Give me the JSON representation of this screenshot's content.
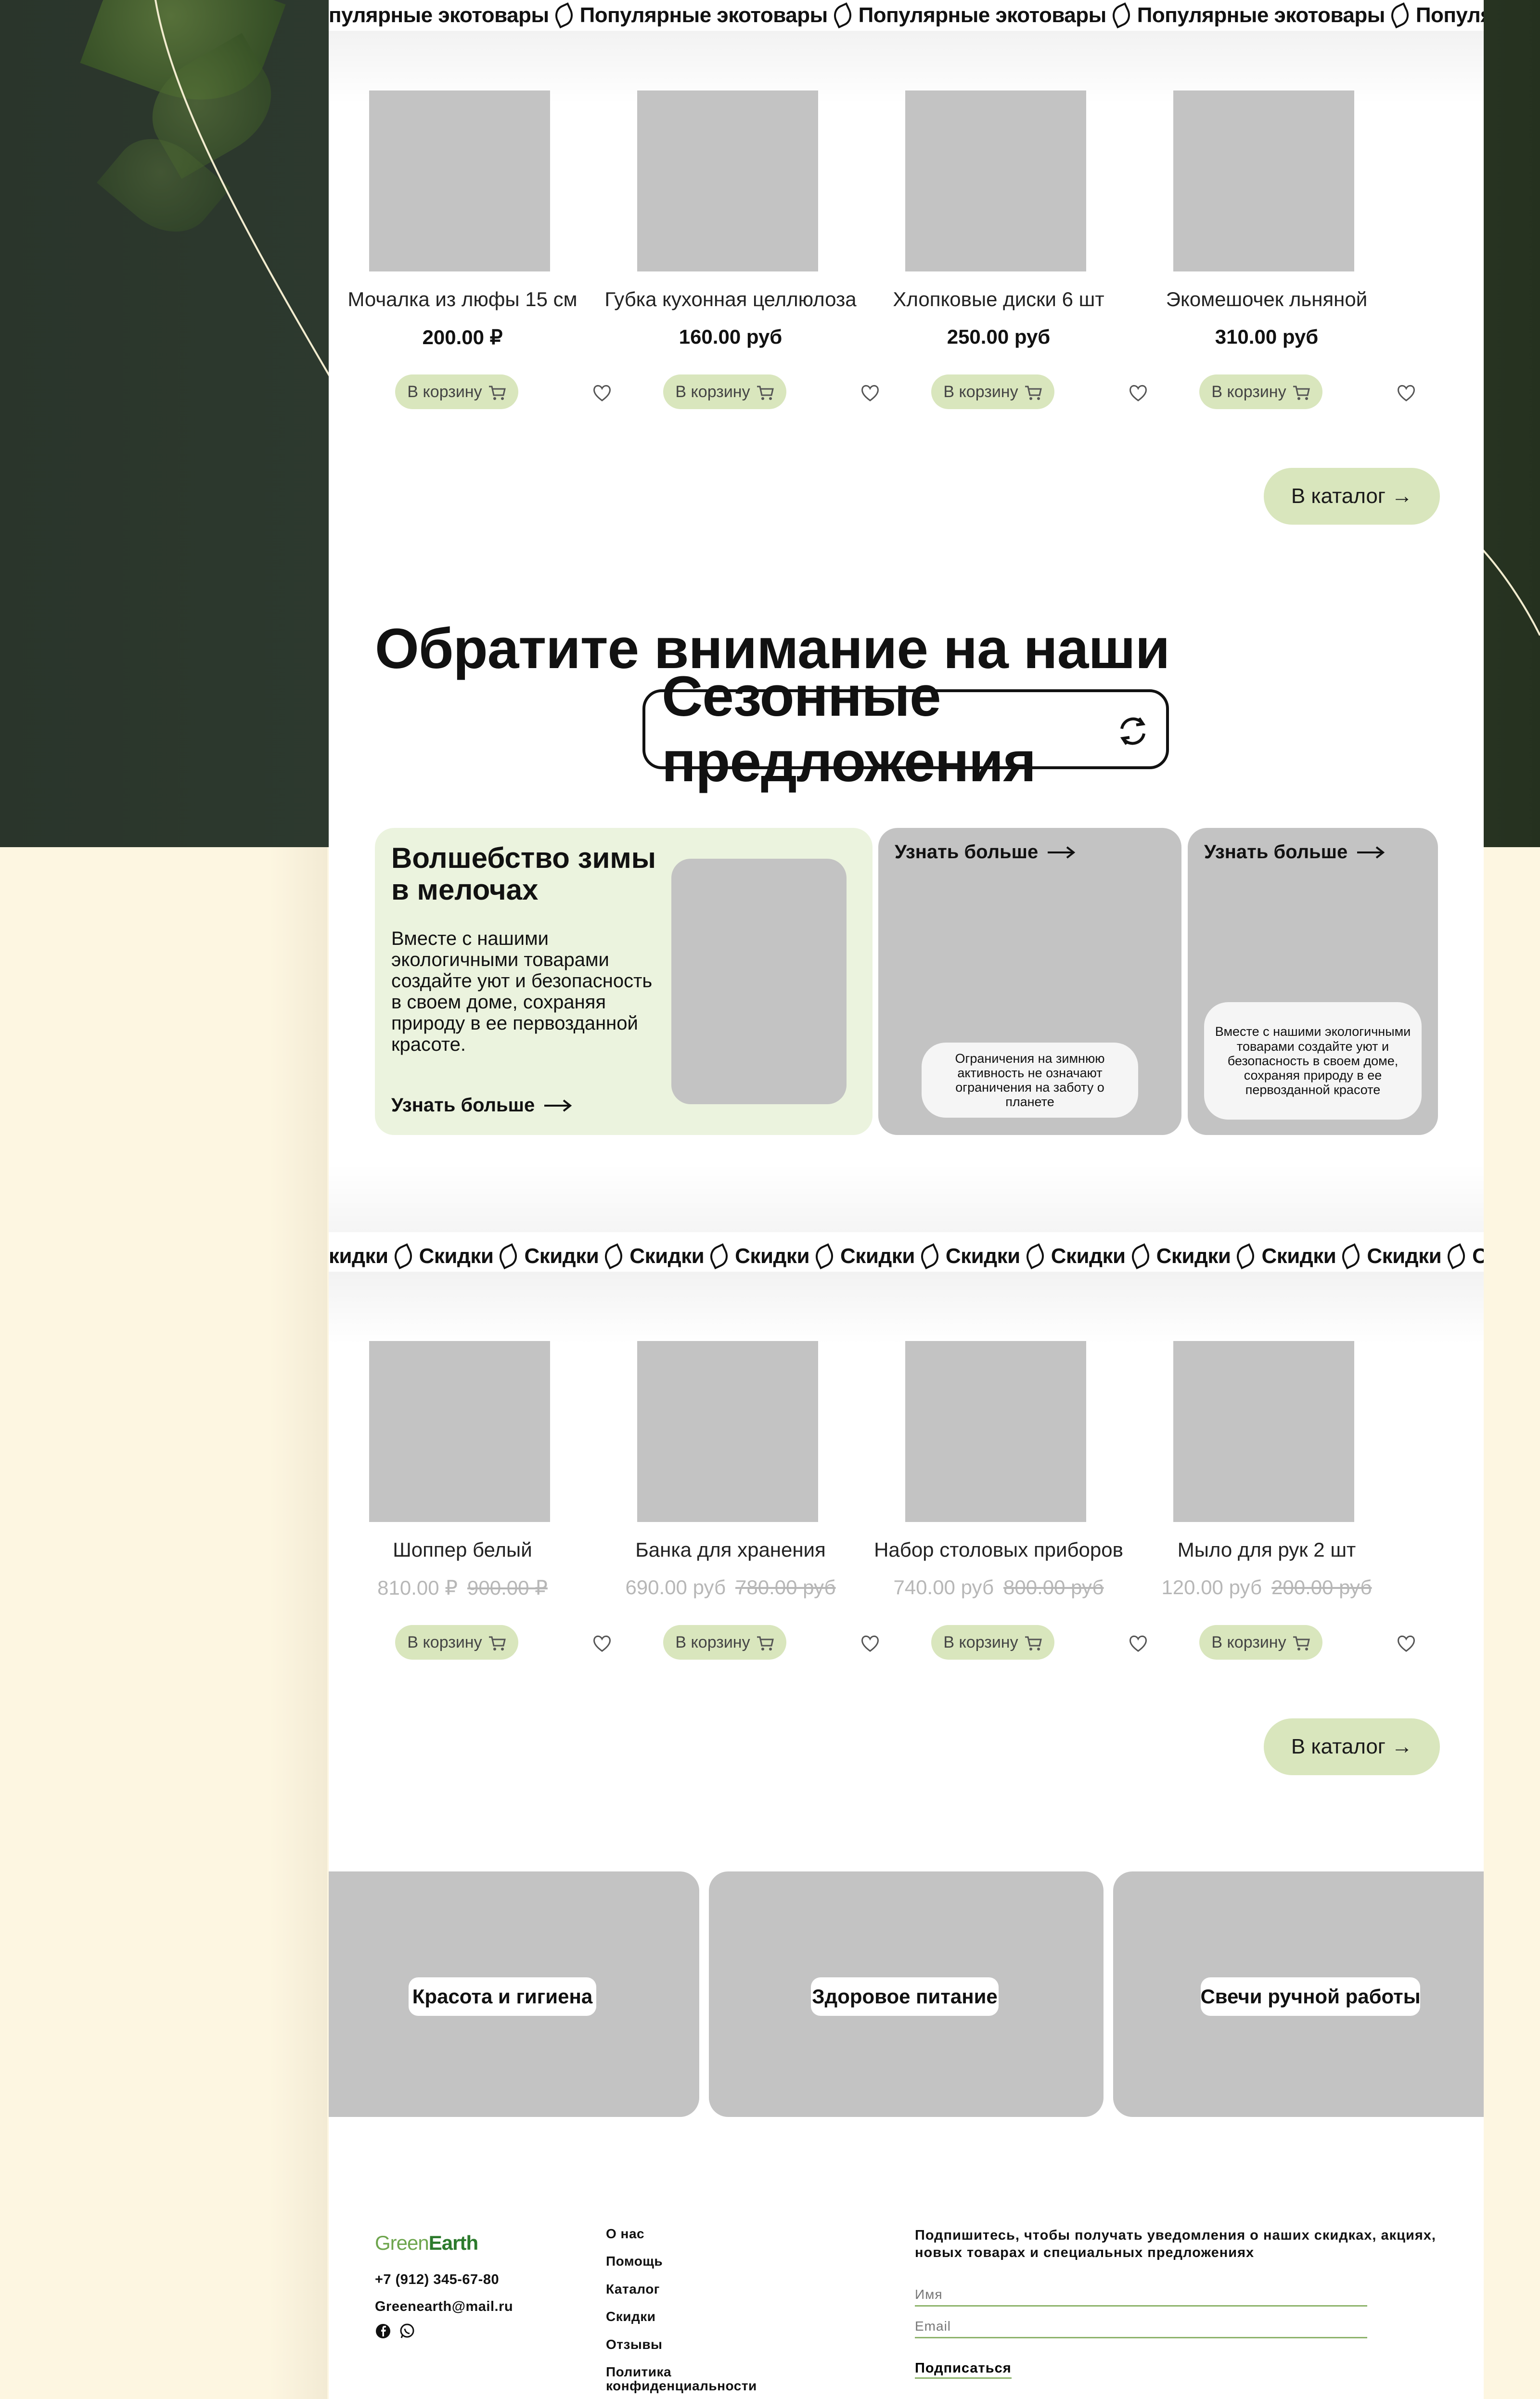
{
  "colors": {
    "accent": "#d9e6bd",
    "card_green": "#ebf3de",
    "placeholder_grey": "#c3c3c3",
    "hero_dark": "#2e3b2f",
    "cream": "#fdf6e1",
    "brand_green": "#2c7a2c"
  },
  "popular": {
    "ticker_text": "Популярные экотовары",
    "ticker_left_partial": "пулярные экотовары",
    "products": [
      {
        "name": "Мочалка из люфы 15 см",
        "price": "200.00 ₽"
      },
      {
        "name": "Губка кухонная целлюлоза",
        "price": "160.00 руб"
      },
      {
        "name": "Хлопковые диски 6 шт",
        "price": "250.00 руб"
      },
      {
        "name": "Экомешочек льняной",
        "price": "310.00 руб"
      }
    ],
    "cart_label": "В корзину",
    "catalog_label": "В каталог →"
  },
  "season": {
    "heading": "Обратите внимание на наши",
    "pill": "Сезонные предложения",
    "main_card": {
      "title": "Волшебство зимы в мелочах",
      "desc": "Вместе с нашими экологичными товарами создайте уют и безопасность в своем доме, сохраняя природу в ее первозданной красоте.",
      "more": "Узнать больше"
    },
    "card2": {
      "more": "Узнать больше",
      "note": "Ограничения на зимнюю активность не означают ограничения на заботу о планете"
    },
    "card3": {
      "more": "Узнать больше",
      "note": "Вместе с нашими экологичными товарами создайте уют и безопасность в своем доме, сохраняя природу в ее первозданной красоте"
    }
  },
  "discounts": {
    "ticker_text": "Скидки",
    "ticker_left_partial": "кидки",
    "products": [
      {
        "name": "Шоппер белый",
        "price": "810.00 ₽",
        "old_price": "900.00 ₽"
      },
      {
        "name": "Банка для хранения",
        "price": "690.00 руб",
        "old_price": "780.00 руб"
      },
      {
        "name": "Набор столовых приборов",
        "price": "740.00 руб",
        "old_price": "800.00 руб"
      },
      {
        "name": "Мыло для рук 2 шт",
        "price": "120.00 руб",
        "old_price": "200.00 руб"
      }
    ],
    "cart_label": "В корзину",
    "catalog_label": "В каталог →"
  },
  "categories": [
    "Красота и гигиена",
    "Здоровое питание",
    "Свечи ручной работы"
  ],
  "footer": {
    "logo_green": "Green",
    "logo_earth": "Earth",
    "phone": "+7 (912) 345-67-80",
    "email": "Greenearth@mail.ru",
    "links": [
      "О нас",
      "Помощь",
      "Каталог",
      "Скидки",
      "Отзывы",
      "Политика конфиденциальности"
    ],
    "subscribe_text": "Подпишитесь, чтобы получать уведомления о наших скидках, акциях, новых товарах и специальных предложениях",
    "name_placeholder": "Имя",
    "email_placeholder": "Email",
    "subscribe_button": "Подписаться",
    "icons": [
      "facebook-icon",
      "whatsapp-icon"
    ]
  }
}
